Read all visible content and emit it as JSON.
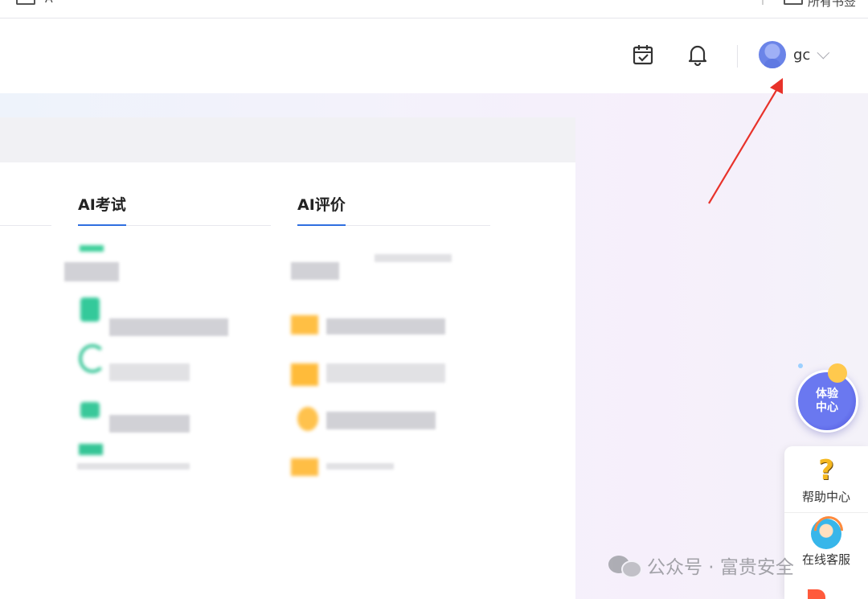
{
  "browser": {
    "title_fragment": "A",
    "bookmark_fragment": "所有书签"
  },
  "header": {
    "user_name": "gc"
  },
  "columns": [
    {
      "title": "AI考试"
    },
    {
      "title": "AI评价"
    }
  ],
  "floating": {
    "experience_line1": "体验",
    "experience_line2": "中心",
    "help_label": "帮助中心",
    "service_label": "在线客服"
  },
  "watermark": {
    "text": "公众号 · 富贵安全"
  },
  "colors": {
    "accent_blue": "#2f6fe0",
    "annotation_red": "#e8322a",
    "experience_purple": "#5b5fe0",
    "help_yellow": "#f5b820"
  }
}
